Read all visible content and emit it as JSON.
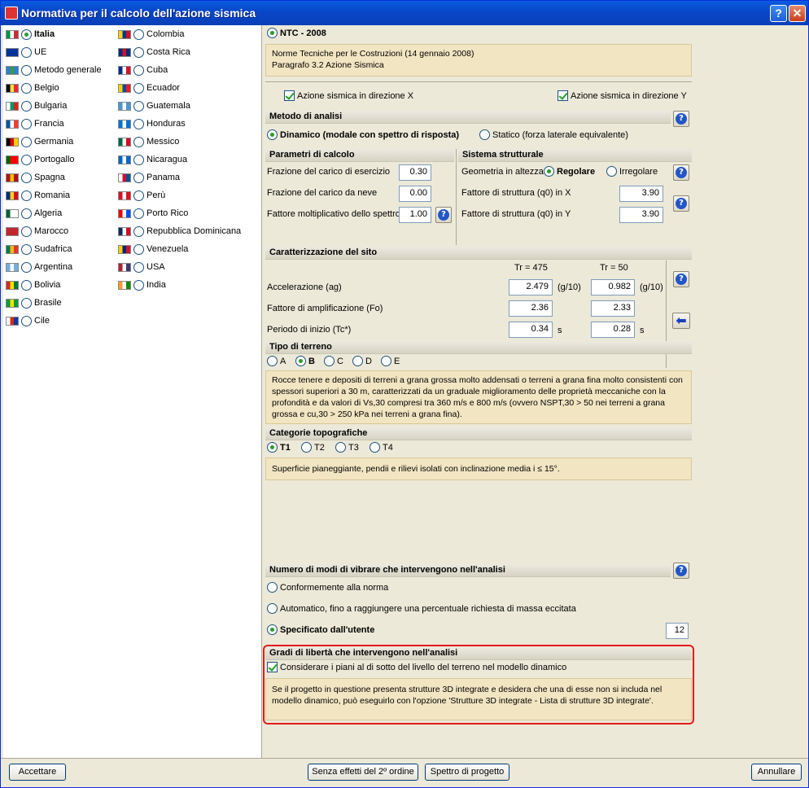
{
  "window": {
    "title": "Normativa per il calcolo dell'azione sismica",
    "help": "?",
    "close": "✕"
  },
  "countries_col1": [
    {
      "name": "Italia",
      "selected": true,
      "flag": [
        "#009246",
        "#fff",
        "#ce2b37"
      ]
    },
    {
      "name": "UE",
      "selected": false,
      "flag": [
        "#039",
        "#039",
        "#039"
      ]
    },
    {
      "name": "Metodo generale",
      "selected": false,
      "flag": [
        "#2a7fd4",
        "#3a9a3a",
        "#2a7fd4"
      ]
    },
    {
      "name": "Belgio",
      "selected": false,
      "flag": [
        "#000",
        "#fae042",
        "#ed2939"
      ]
    },
    {
      "name": "Bulgaria",
      "selected": false,
      "flag": [
        "#fff",
        "#00966e",
        "#d62612"
      ]
    },
    {
      "name": "Francia",
      "selected": false,
      "flag": [
        "#0055a4",
        "#fff",
        "#ef4135"
      ]
    },
    {
      "name": "Germania",
      "selected": false,
      "flag": [
        "#000",
        "#dd0000",
        "#ffce00"
      ]
    },
    {
      "name": "Portogallo",
      "selected": false,
      "flag": [
        "#006600",
        "#ff0000",
        "#ff0000"
      ]
    },
    {
      "name": "Spagna",
      "selected": false,
      "flag": [
        "#aa151b",
        "#f1bf00",
        "#aa151b"
      ]
    },
    {
      "name": "Romania",
      "selected": false,
      "flag": [
        "#002b7f",
        "#fcd116",
        "#ce1126"
      ]
    },
    {
      "name": "Algeria",
      "selected": false,
      "flag": [
        "#006233",
        "#fff",
        "#fff"
      ]
    },
    {
      "name": "Marocco",
      "selected": false,
      "flag": [
        "#c1272d",
        "#c1272d",
        "#c1272d"
      ]
    },
    {
      "name": "Sudafrica",
      "selected": false,
      "flag": [
        "#007a4d",
        "#ffb612",
        "#de3831"
      ]
    },
    {
      "name": "Argentina",
      "selected": false,
      "flag": [
        "#74acdf",
        "#fff",
        "#74acdf"
      ]
    },
    {
      "name": "Bolivia",
      "selected": false,
      "flag": [
        "#d52b1e",
        "#f9e300",
        "#007934"
      ]
    },
    {
      "name": "Brasile",
      "selected": false,
      "flag": [
        "#009c3b",
        "#ffdf00",
        "#009c3b"
      ]
    },
    {
      "name": "Cile",
      "selected": false,
      "flag": [
        "#fff",
        "#d52b1e",
        "#0039a6"
      ]
    }
  ],
  "countries_col2": [
    {
      "name": "Colombia",
      "selected": false,
      "flag": [
        "#fcd116",
        "#003893",
        "#ce1126"
      ]
    },
    {
      "name": "Costa Rica",
      "selected": false,
      "flag": [
        "#002b7f",
        "#ce1126",
        "#002b7f"
      ]
    },
    {
      "name": "Cuba",
      "selected": false,
      "flag": [
        "#002a8f",
        "#fff",
        "#cf142b"
      ]
    },
    {
      "name": "Ecuador",
      "selected": false,
      "flag": [
        "#ffd100",
        "#034ea2",
        "#ed1c24"
      ]
    },
    {
      "name": "Guatemala",
      "selected": false,
      "flag": [
        "#4997d0",
        "#fff",
        "#4997d0"
      ]
    },
    {
      "name": "Honduras",
      "selected": false,
      "flag": [
        "#0073cf",
        "#fff",
        "#0073cf"
      ]
    },
    {
      "name": "Messico",
      "selected": false,
      "flag": [
        "#006847",
        "#fff",
        "#ce1126"
      ]
    },
    {
      "name": "Nicaragua",
      "selected": false,
      "flag": [
        "#0067c6",
        "#fff",
        "#0067c6"
      ]
    },
    {
      "name": "Panama",
      "selected": false,
      "flag": [
        "#fff",
        "#d21034",
        "#005293"
      ]
    },
    {
      "name": "Perù",
      "selected": false,
      "flag": [
        "#d91023",
        "#fff",
        "#d91023"
      ]
    },
    {
      "name": "Porto Rico",
      "selected": false,
      "flag": [
        "#ed0000",
        "#fff",
        "#0050f0"
      ]
    },
    {
      "name": "Repubblica Dominicana",
      "selected": false,
      "flag": [
        "#002d62",
        "#fff",
        "#ce1126"
      ]
    },
    {
      "name": "Venezuela",
      "selected": false,
      "flag": [
        "#ffcc00",
        "#00247d",
        "#cf142b"
      ]
    },
    {
      "name": "USA",
      "selected": false,
      "flag": [
        "#b22234",
        "#fff",
        "#3c3b6e"
      ]
    },
    {
      "name": "India",
      "selected": false,
      "flag": [
        "#ff9933",
        "#fff",
        "#138808"
      ]
    }
  ],
  "norm": {
    "label": "NTC - 2008",
    "desc1": "Norme Tecniche per le Costruzioni (14 gennaio 2008)",
    "desc2": "Paragrafo 3.2 Azione Sismica"
  },
  "directions": {
    "x": "Azione sismica in direzione X",
    "y": "Azione sismica in direzione Y"
  },
  "metodo": {
    "title": "Metodo di analisi",
    "dinamico": "Dinamico (modale con spettro di risposta)",
    "statico": "Statico (forza laterale equivalente)"
  },
  "parametri": {
    "title": "Parametri di calcolo",
    "esercizio_label": "Frazione del carico di esercizio",
    "esercizio": "0.30",
    "neve_label": "Frazione del carico da neve",
    "neve": "0.00",
    "spettro_label": "Fattore moltiplicativo dello spettro",
    "spettro": "1.00"
  },
  "sistema": {
    "title": "Sistema strutturale",
    "geometria_label": "Geometria in altezza",
    "regolare": "Regolare",
    "irregolare": "Irregolare",
    "qx_label": "Fattore di struttura (q0) in X",
    "qx": "3.90",
    "qy_label": "Fattore di struttura (q0) in Y",
    "qy": "3.90"
  },
  "sito": {
    "title": "Caratterizzazione del sito",
    "tr1": "Tr = 475",
    "tr2": "Tr = 50",
    "acc_label": "Accelerazione (ag)",
    "acc1": "2.479",
    "acc2": "0.982",
    "acc_unit": "(g/10)",
    "fo_label": "Fattore di amplificazione (Fo)",
    "fo1": "2.36",
    "fo2": "2.33",
    "tc_label": "Periodo di inizio (Tc*)",
    "tc1": "0.34",
    "tc2": "0.28",
    "tc_unit": "s"
  },
  "terreno": {
    "title": "Tipo di terreno",
    "options": [
      "A",
      "B",
      "C",
      "D",
      "E"
    ],
    "selected": "B",
    "desc": "Rocce tenere e depositi di terreni a grana grossa molto addensati o terreni a grana fina molto consistenti con spessori superiori a 30 m, caratterizzati da un graduale miglioramento delle proprietà meccaniche con la profondità e da valori di Vs,30 compresi tra 360 m/s e 800 m/s (ovvero NSPT,30 > 50 nei terreni a grana grossa e cu,30 > 250 kPa nei terreni a grana fina)."
  },
  "topo": {
    "title": "Categorie topografiche",
    "options": [
      "T1",
      "T2",
      "T3",
      "T4"
    ],
    "selected": "T1",
    "desc": "Superficie pianeggiante, pendii e rilievi isolati con inclinazione media i ≤ 15°."
  },
  "modi": {
    "title": "Numero di modi di vibrare che intervengono nell'analisi",
    "opt1": "Conformemente alla norma",
    "opt2": "Automatico, fino a raggiungere una percentuale richiesta di massa eccitata",
    "opt3": "Specificato dall'utente",
    "value": "12"
  },
  "gradi": {
    "title": "Gradi di libertà che intervengono nell'analisi",
    "check": "Considerare i piani al di sotto del livello del terreno nel modello dinamico",
    "desc": "Se il progetto in questione presenta strutture 3D integrate e desidera che una di esse non si includa nel modello dinamico, può eseguirlo con l'opzione 'Strutture 3D integrate - Lista di strutture 3D integrate'."
  },
  "buttons": {
    "accept": "Accettare",
    "senza": "Senza effetti del 2º ordine",
    "spettro": "Spettro di progetto",
    "cancel": "Annullare"
  },
  "help_glyph": "?",
  "arrow_glyph": "⬅"
}
